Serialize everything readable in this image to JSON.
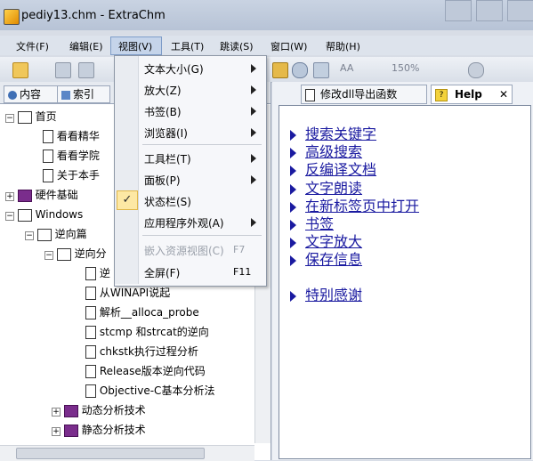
{
  "window": {
    "title": "pediy13.chm - ExtraChm"
  },
  "menubar": [
    {
      "label": "文件(F)"
    },
    {
      "label": "编辑(E)"
    },
    {
      "label": "视图(V)"
    },
    {
      "label": "工具(T)"
    },
    {
      "label": "跳读(S)"
    },
    {
      "label": "窗口(W)"
    },
    {
      "label": "帮助(H)"
    }
  ],
  "toolbar": {
    "zoom_label": "150%"
  },
  "left_tabs": {
    "contents": "内容",
    "index": "索引"
  },
  "tree": [
    {
      "label": "首页",
      "level": 1
    },
    {
      "label": "看看精华",
      "level": 2
    },
    {
      "label": "看看学院",
      "level": 2
    },
    {
      "label": "关于本手",
      "level": 2
    },
    {
      "label": "硬件基础",
      "level": 1
    },
    {
      "label": "Windows",
      "level": 1
    },
    {
      "label": "逆向篇",
      "level": 2
    },
    {
      "label": "逆向分",
      "level": 3
    },
    {
      "label": "逆",
      "level": 4
    },
    {
      "label": "从WINAPI说起",
      "level": 4
    },
    {
      "label": "解析__alloca_probe",
      "level": 4
    },
    {
      "label": "stcmp 和strcat的逆向",
      "level": 4
    },
    {
      "label": "chkstk执行过程分析",
      "level": 4
    },
    {
      "label": "Release版本逆向代码",
      "level": 4
    },
    {
      "label": "Objective-C基本分析法",
      "level": 4
    },
    {
      "label": "动态分析技术",
      "level": 3
    },
    {
      "label": "静态分析技术",
      "level": 3
    }
  ],
  "right_tabs": {
    "tab1": "修改dll导出函数",
    "tab2": "Help"
  },
  "help_links": [
    "搜索关键字",
    "高级搜索",
    "反编译文档",
    "文字朗读",
    "在新标签页中打开",
    "书签",
    "文字放大",
    "保存信息",
    "特别感谢"
  ],
  "view_menu": {
    "items": [
      {
        "label": "文本大小(G)",
        "submenu": true
      },
      {
        "label": "放大(Z)",
        "submenu": true
      },
      {
        "label": "书签(B)",
        "submenu": true
      },
      {
        "label": "浏览器(I)",
        "submenu": true
      },
      {
        "label": "工具栏(T)",
        "submenu": true
      },
      {
        "label": "面板(P)",
        "submenu": true
      },
      {
        "label": "状态栏(S)",
        "checked": true
      },
      {
        "label": "应用程序外观(A)",
        "submenu": true
      },
      {
        "label": "嵌入资源视图(C)",
        "shortcut": "F7",
        "disabled": true
      },
      {
        "label": "全屏(F)",
        "shortcut": "F11"
      }
    ],
    "check_mark": "✓"
  }
}
